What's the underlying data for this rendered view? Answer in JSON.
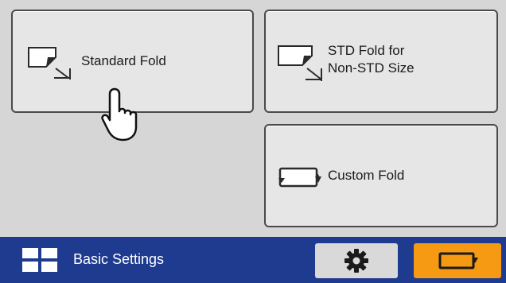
{
  "buttons": {
    "standard_fold": "Standard Fold",
    "std_fold_nonstd": {
      "line1": "STD Fold for",
      "line2": "Non-STD Size"
    },
    "custom_fold": "Custom Fold"
  },
  "bottom_bar": {
    "title": "Basic Settings",
    "menu_icon": "grid-icon",
    "settings_icon": "gear-icon",
    "fold_mode_icon": "fold-mode-icon"
  },
  "colors": {
    "bottom_bar": "#1f3b8f",
    "accent_orange": "#f59a12",
    "button_face": "#e6e6e6"
  }
}
